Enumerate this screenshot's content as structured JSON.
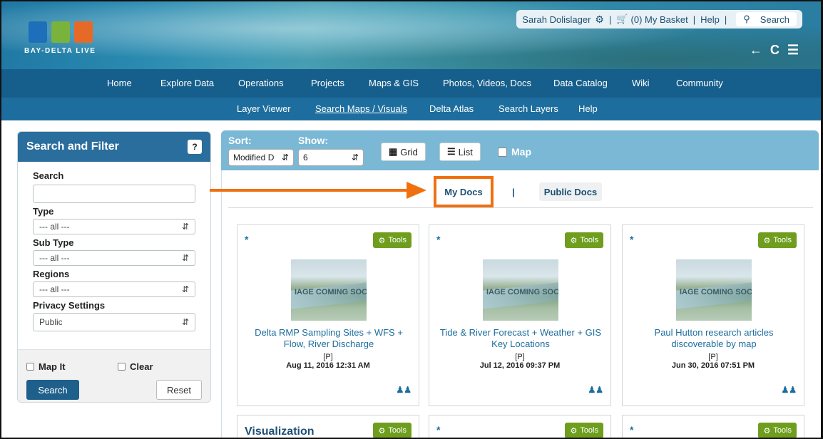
{
  "header": {
    "logo_text": "BAY-DELTA LIVE",
    "user_name": "Sarah Dolislager",
    "basket": "(0) My Basket",
    "help": "Help",
    "search": "Search",
    "nav_arrows": "← C ☰"
  },
  "nav_primary": [
    {
      "label": "Home"
    },
    {
      "label": "Explore Data"
    },
    {
      "label": "Operations"
    },
    {
      "label": "Projects"
    },
    {
      "label": "Maps & GIS"
    },
    {
      "label": "Photos, Videos, Docs"
    },
    {
      "label": "Data Catalog"
    },
    {
      "label": "Wiki"
    },
    {
      "label": "Community"
    }
  ],
  "nav_secondary": [
    {
      "label": "Layer Viewer"
    },
    {
      "label": "Search Maps / Visuals",
      "active": true
    },
    {
      "label": "Delta Atlas"
    },
    {
      "label": "Search Layers"
    },
    {
      "label": "Help"
    }
  ],
  "filter": {
    "title": "Search and Filter",
    "help_label": "?",
    "search_label": "Search",
    "search_value": "",
    "type_label": "Type",
    "type_value": "--- all ---",
    "subtype_label": "Sub Type",
    "subtype_value": "--- all ---",
    "regions_label": "Regions",
    "regions_value": "--- all ---",
    "privacy_label": "Privacy Settings",
    "privacy_value": "Public",
    "map_it": "Map It",
    "clear": "Clear",
    "search_button": "Search",
    "reset_button": "Reset"
  },
  "toolbar": {
    "sort_label": "Sort:",
    "sort_value": "Modified D",
    "show_label": "Show:",
    "show_value": "6",
    "grid_label": "Grid",
    "list_label": "List",
    "map_label": "Map"
  },
  "doc_tabs": {
    "my_docs": "My Docs",
    "separator": "|",
    "public_docs": "Public Docs"
  },
  "cards": [
    {
      "star": "*",
      "tools": "Tools",
      "thumb_text": "IAGE COMING SOC",
      "title": "Delta RMP Sampling Sites + WFS + Flow, River Discharge",
      "privacy": "[P]",
      "date": "Aug 11, 2016 12:31 AM"
    },
    {
      "star": "*",
      "tools": "Tools",
      "thumb_text": "IAGE COMING SOC",
      "title": "Tide & River Forecast + Weather + GIS Key Locations",
      "privacy": "[P]",
      "date": "Jul 12, 2016 09:37 PM"
    },
    {
      "star": "*",
      "tools": "Tools",
      "thumb_text": "IAGE COMING SOC",
      "title": "Paul Hutton research articles discoverable by map",
      "privacy": "[P]",
      "date": "Jun 30, 2016 07:51 PM"
    }
  ],
  "cards_row2": [
    {
      "title": "Visualization",
      "tools": "Tools"
    },
    {
      "star": "*",
      "tools": "Tools"
    },
    {
      "star": "*",
      "tools": "Tools"
    }
  ],
  "colors": {
    "accent_orange": "#f07010",
    "nav_blue": "#165f8c",
    "tools_green": "#6f9e1f",
    "sortbar_blue": "#7ab8d6"
  }
}
